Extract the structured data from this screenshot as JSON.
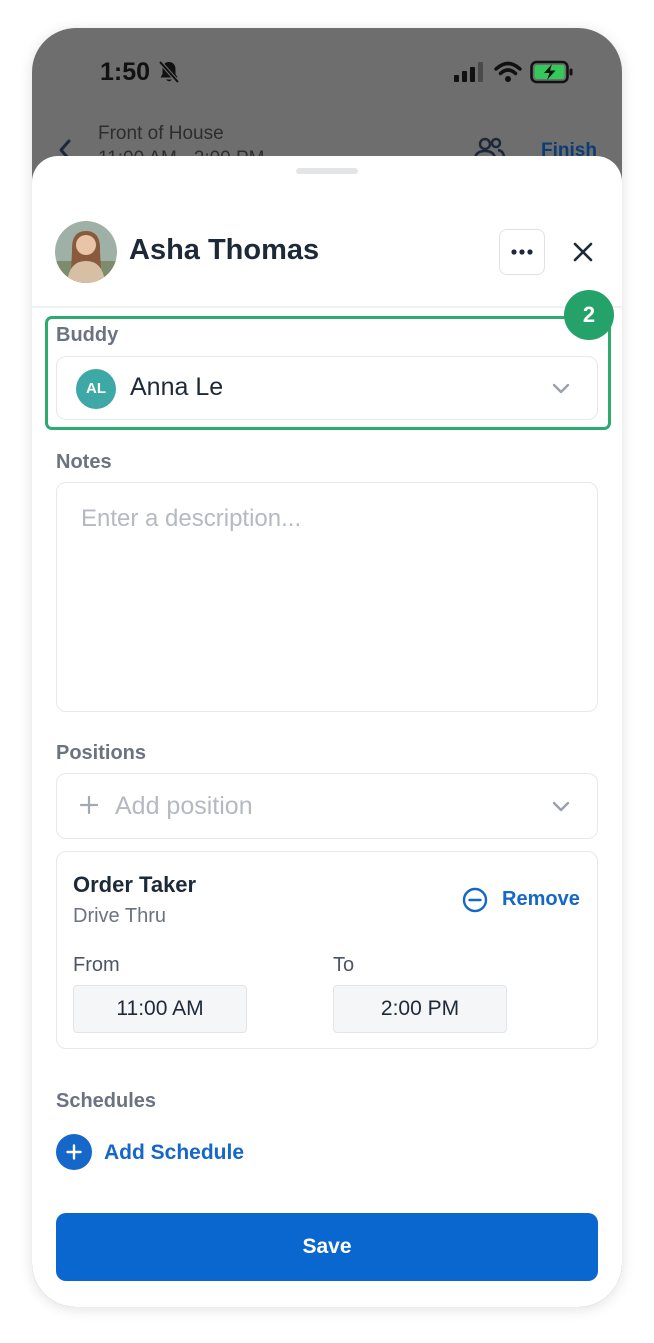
{
  "status_bar": {
    "time": "1:50"
  },
  "background_header": {
    "title": "Front of House",
    "subtitle": "11:00 AM - 2:00 PM",
    "finish_label": "Finish"
  },
  "sheet": {
    "employee_name": "Asha Thomas",
    "buddy": {
      "label": "Buddy",
      "initials": "AL",
      "name": "Anna Le"
    },
    "step_badge": "2",
    "notes": {
      "label": "Notes",
      "placeholder": "Enter a description...",
      "value": ""
    },
    "positions": {
      "label": "Positions",
      "add_placeholder": "Add position",
      "items": [
        {
          "title": "Order Taker",
          "subtitle": "Drive Thru",
          "remove_label": "Remove",
          "from_label": "From",
          "from_value": "11:00 AM",
          "to_label": "To",
          "to_value": "2:00 PM"
        }
      ]
    },
    "schedules": {
      "label": "Schedules",
      "add_label": "Add Schedule"
    },
    "save_label": "Save"
  },
  "colors": {
    "accent": "#1567c9",
    "save_button": "#0a67d0",
    "highlight": "#2daa6e",
    "buddy_avatar": "#3ea8a6",
    "overlay": "#6e6e6e"
  }
}
